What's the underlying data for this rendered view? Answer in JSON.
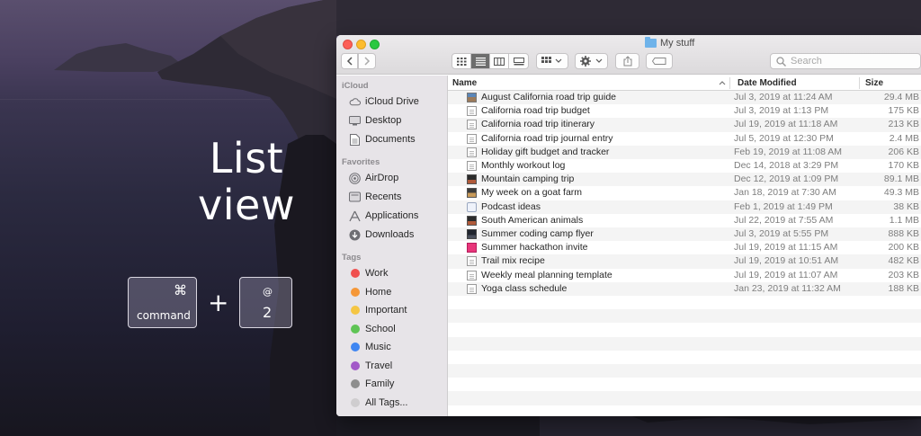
{
  "overlay": {
    "title_line1": "List",
    "title_line2": "view",
    "key1_glyph": "⌘",
    "key1_label": "command",
    "plus": "+",
    "key2_glyph": "@",
    "key2_label": "2"
  },
  "window": {
    "title": "My stuff",
    "search_placeholder": "Search"
  },
  "sidebar": {
    "sections": [
      {
        "heading": "iCloud",
        "items": [
          {
            "label": "iCloud Drive",
            "icon": "cloud-icon"
          },
          {
            "label": "Desktop",
            "icon": "desktop-icon"
          },
          {
            "label": "Documents",
            "icon": "documents-icon"
          }
        ]
      },
      {
        "heading": "Favorites",
        "items": [
          {
            "label": "AirDrop",
            "icon": "airdrop-icon"
          },
          {
            "label": "Recents",
            "icon": "recents-icon"
          },
          {
            "label": "Applications",
            "icon": "applications-icon"
          },
          {
            "label": "Downloads",
            "icon": "downloads-icon"
          }
        ]
      },
      {
        "heading": "Tags",
        "items": [
          {
            "label": "Work",
            "color": "#f0504f"
          },
          {
            "label": "Home",
            "color": "#f59738"
          },
          {
            "label": "Important",
            "color": "#f5c644"
          },
          {
            "label": "School",
            "color": "#5fc455"
          },
          {
            "label": "Music",
            "color": "#3f86f2"
          },
          {
            "label": "Travel",
            "color": "#a259c8"
          },
          {
            "label": "Family",
            "color": "#8e8e8e"
          },
          {
            "label": "All Tags...",
            "color": "#cfcdcf"
          }
        ]
      }
    ]
  },
  "list": {
    "columns": {
      "name": "Name",
      "date": "Date Modified",
      "size": "Size"
    },
    "files": [
      {
        "name": "August California road trip guide",
        "date": "Jul 3, 2019 at 11:24 AM",
        "size": "29.4 MB",
        "icon": "fi-img"
      },
      {
        "name": "California road trip budget",
        "date": "Jul 3, 2019 at 1:13 PM",
        "size": "175 KB",
        "icon": "fi-doc"
      },
      {
        "name": "California road trip itinerary",
        "date": "Jul 19, 2019 at 11:18 AM",
        "size": "213 KB",
        "icon": "fi-doc"
      },
      {
        "name": "California road trip journal entry",
        "date": "Jul 5, 2019 at 12:30 PM",
        "size": "2.4 MB",
        "icon": "fi-doc"
      },
      {
        "name": "Holiday gift budget and tracker",
        "date": "Feb 19, 2019 at 11:08 AM",
        "size": "206 KB",
        "icon": "fi-doc"
      },
      {
        "name": "Monthly workout log",
        "date": "Dec 14, 2018 at 3:29 PM",
        "size": "170 KB",
        "icon": "fi-doc"
      },
      {
        "name": "Mountain camping trip",
        "date": "Dec 12, 2019 at 1:09 PM",
        "size": "89.1 MB",
        "icon": "fi-dark"
      },
      {
        "name": "My week on a goat farm",
        "date": "Jan 18, 2019 at 7:30 AM",
        "size": "49.3 MB",
        "icon": "fi-goat"
      },
      {
        "name": "Podcast ideas",
        "date": "Feb 1, 2019 at 1:49 PM",
        "size": "38 KB",
        "icon": "fi-pod"
      },
      {
        "name": "South American animals",
        "date": "Jul 22, 2019 at 7:55 AM",
        "size": "1.1 MB",
        "icon": "fi-dark"
      },
      {
        "name": "Summer coding camp flyer",
        "date": "Jul 3, 2019 at 5:55 PM",
        "size": "888 KB",
        "icon": "fi-poster"
      },
      {
        "name": "Summer hackathon invite",
        "date": "Jul 19, 2019 at 11:15 AM",
        "size": "200 KB",
        "icon": "fi-pink"
      },
      {
        "name": "Trail mix recipe",
        "date": "Jul 19, 2019 at 10:51 AM",
        "size": "482 KB",
        "icon": "fi-doc"
      },
      {
        "name": "Weekly meal planning template",
        "date": "Jul 19, 2019 at 11:07 AM",
        "size": "203 KB",
        "icon": "fi-doc"
      },
      {
        "name": "Yoga class schedule",
        "date": "Jan 23, 2019 at 11:32 AM",
        "size": "188 KB",
        "icon": "fi-doc"
      }
    ]
  }
}
